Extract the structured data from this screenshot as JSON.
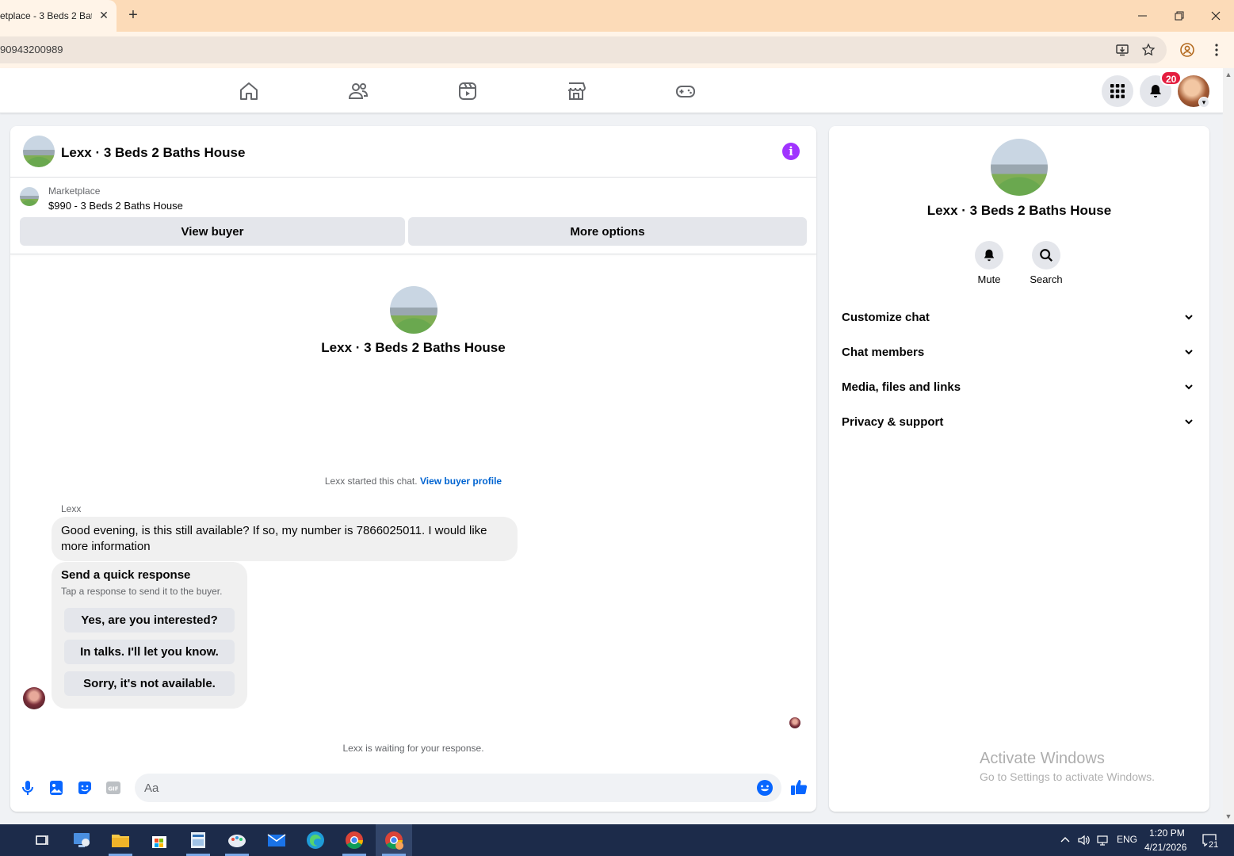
{
  "browser": {
    "tab_title": "etplace - 3 Beds 2 Bat",
    "tab_close": "✕",
    "new_tab": "+",
    "url": "90943200989"
  },
  "fb_nav": {
    "notification_count": "20"
  },
  "conversation": {
    "title": "Lexx · 3 Beds 2 Baths House",
    "info_glyph": "i",
    "marketplace_label": "Marketplace",
    "listing": "$990 - 3 Beds 2 Baths House",
    "view_buyer_label": "View buyer",
    "more_options_label": "More options",
    "center_title": "Lexx · 3 Beds 2 Baths House",
    "started_text": "Lexx started this chat.",
    "view_buyer_profile_link": "View buyer profile",
    "sender_name": "Lexx",
    "message": "Good evening, is this still available? If so, my number is 7866025011. I would like more information",
    "quick_response": {
      "title": "Send a quick response",
      "subtitle": "Tap a response to send it to the buyer.",
      "options": [
        "Yes, are you interested?",
        "In talks. I'll let you know.",
        "Sorry, it's not available."
      ]
    },
    "waiting_text": "Lexx is waiting for your response.",
    "composer_placeholder": "Aa"
  },
  "side_panel": {
    "title": "Lexx · 3 Beds 2 Baths House",
    "actions": [
      "Mute",
      "Search"
    ],
    "sections": [
      "Customize chat",
      "Chat members",
      "Media, files and links",
      "Privacy & support"
    ]
  },
  "watermark": {
    "line1": "Activate Windows",
    "line2": "Go to Settings to activate Windows."
  },
  "taskbar": {
    "language": "ENG",
    "time": "1:20 PM",
    "date": "4/21/2026",
    "notification_count": "21"
  },
  "colors": {
    "tabbar": "#fcdbb8",
    "fb_blue": "#0866ff",
    "info_purple": "#a033ff",
    "badge_red": "#e41e3f"
  }
}
